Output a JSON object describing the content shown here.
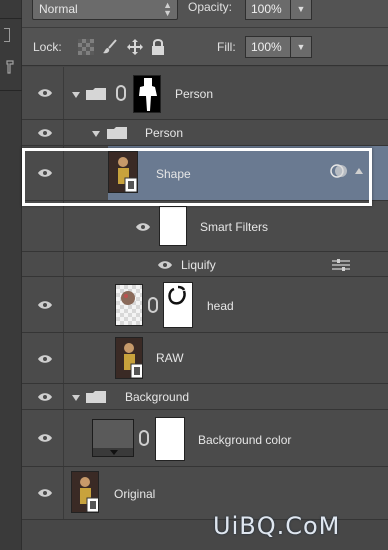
{
  "toolbar": {
    "blend_mode": "Normal",
    "opacity_label": "Opacity:",
    "opacity_value": "100%",
    "lock_label": "Lock:",
    "fill_label": "Fill:",
    "fill_value": "100%"
  },
  "layers": [
    {
      "name": "Person",
      "kind": "group-with-mask"
    },
    {
      "name": "Person",
      "kind": "group"
    },
    {
      "name": "Shape",
      "kind": "smart-object",
      "selected": true
    },
    {
      "name": "Smart Filters",
      "kind": "smart-filters"
    },
    {
      "name": "Liquify",
      "kind": "filter"
    },
    {
      "name": "head",
      "kind": "layer-with-mask"
    },
    {
      "name": "RAW",
      "kind": "smart-object"
    },
    {
      "name": "Background",
      "kind": "group"
    },
    {
      "name": "Background color",
      "kind": "fill-with-mask"
    },
    {
      "name": "Original",
      "kind": "smart-object"
    }
  ],
  "watermark": "UiBQ.CoM",
  "colors": {
    "selected_row": "#6a7a91",
    "panel_bg": "#474747",
    "highlight_border": "#ffffff"
  }
}
